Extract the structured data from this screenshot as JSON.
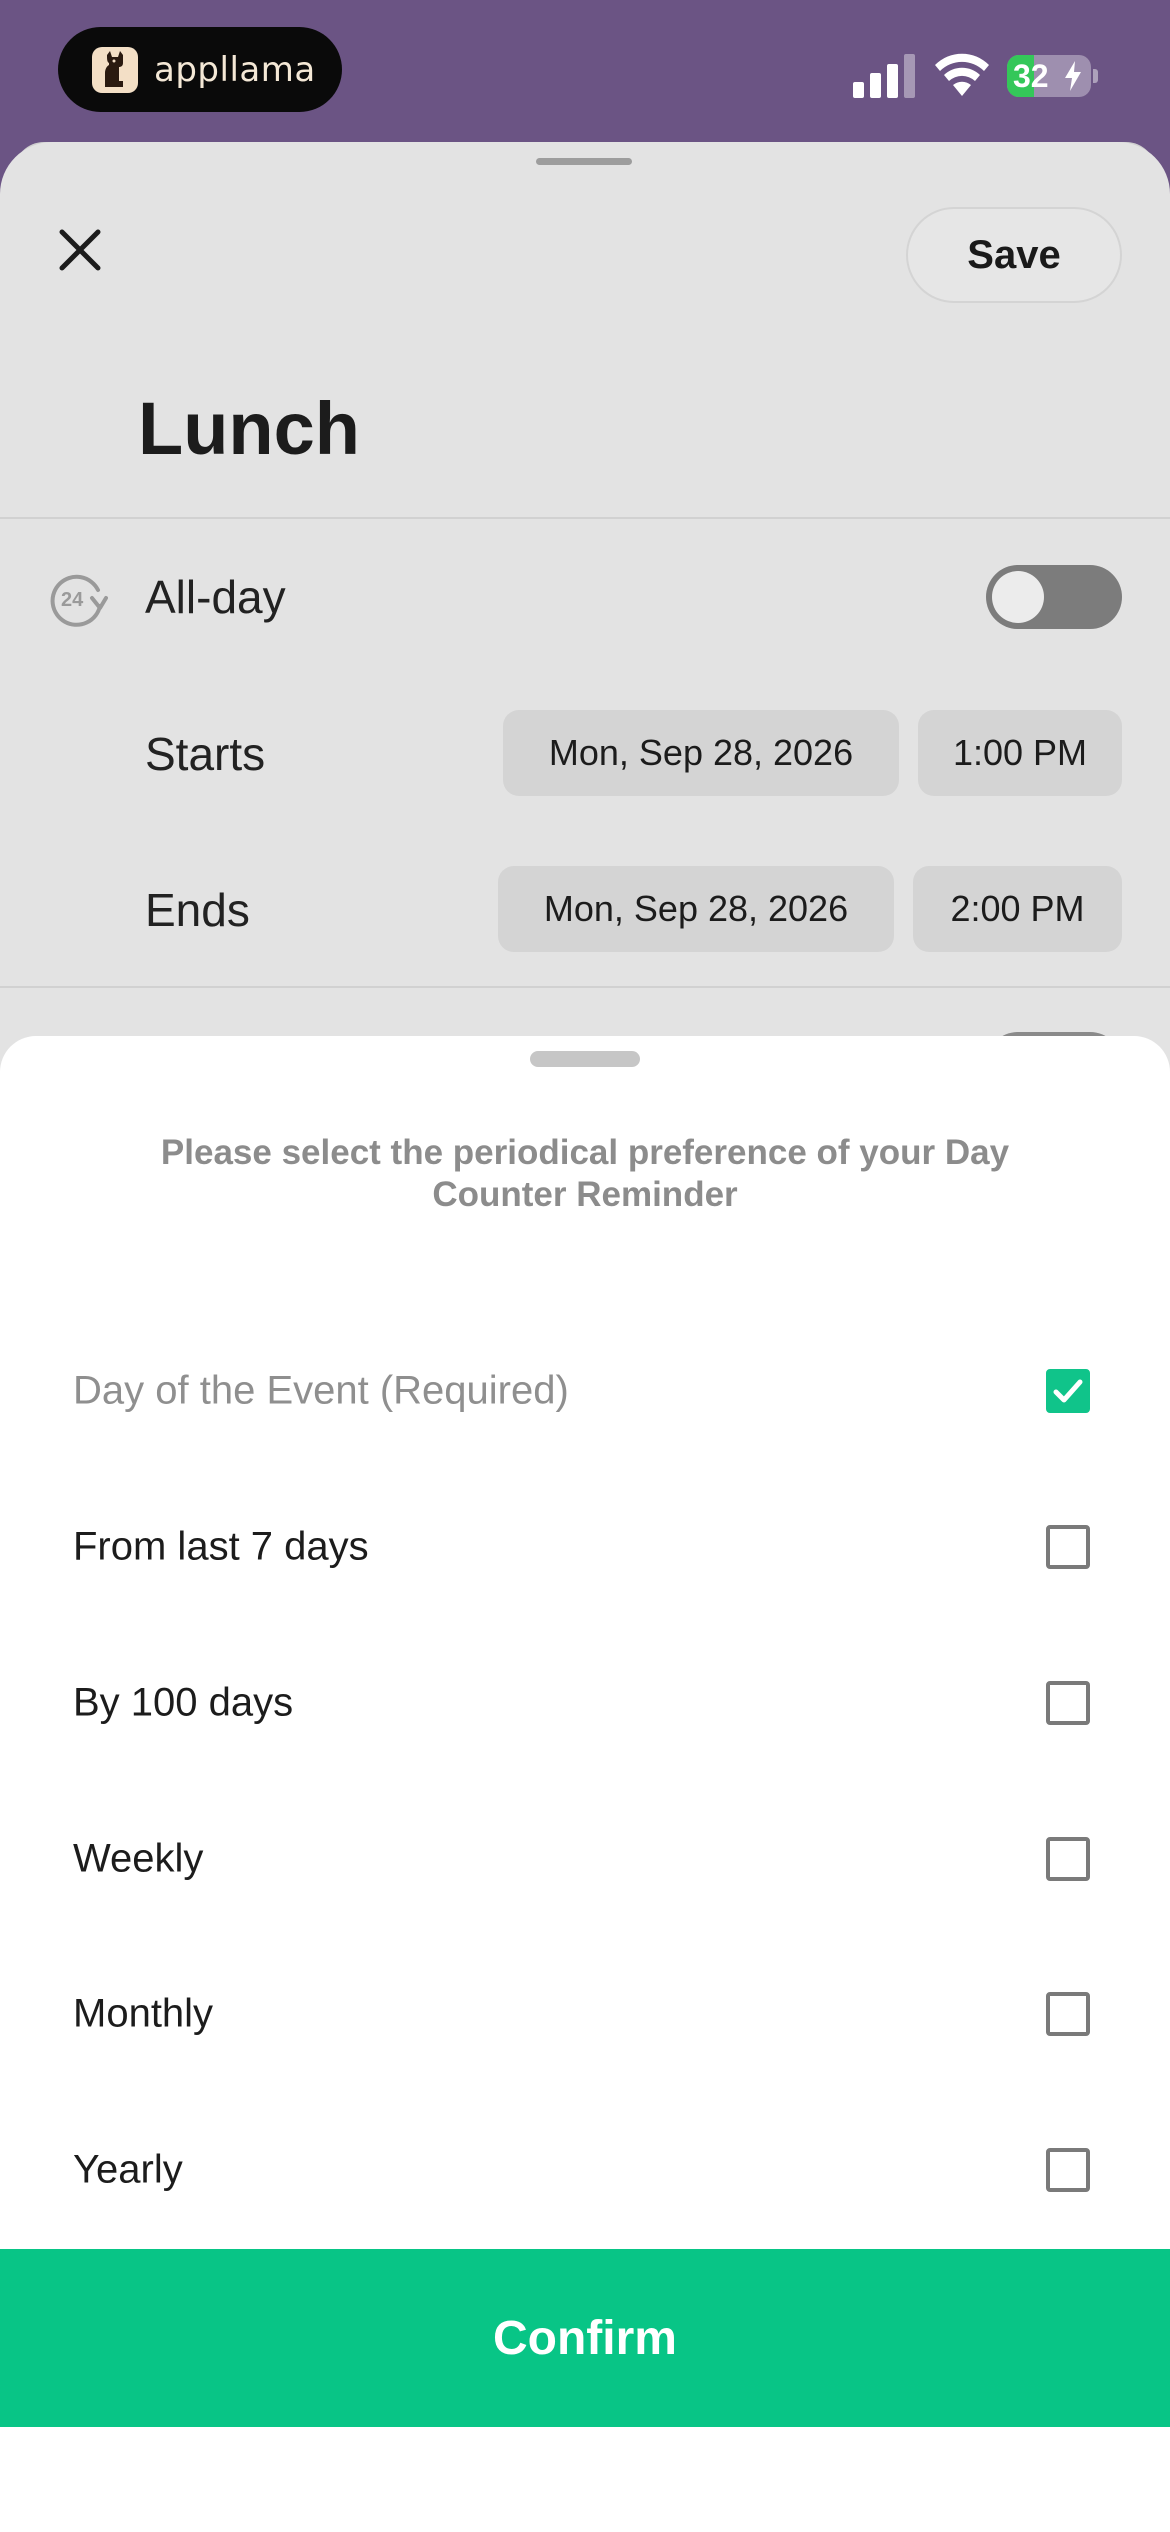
{
  "status_bar": {
    "app_name": "appllama",
    "battery_level": "32",
    "battery_fraction": 0.32
  },
  "event": {
    "close_icon": "close-icon",
    "save_label": "Save",
    "title": "Lunch",
    "all_day_label": "All-day",
    "all_day_on": false,
    "starts_label": "Starts",
    "starts_date": "Mon, Sep 28, 2026",
    "starts_time": "1:00 PM",
    "ends_label": "Ends",
    "ends_date": "Mon, Sep 28, 2026",
    "ends_time": "2:00 PM"
  },
  "reminder_sheet": {
    "prompt": "Please select the periodical preference of your Day Counter Reminder",
    "options": [
      {
        "label": "Day of the Event (Required)",
        "checked": true,
        "disabled": true
      },
      {
        "label": "From last 7 days",
        "checked": false,
        "disabled": false
      },
      {
        "label": "By 100 days",
        "checked": false,
        "disabled": false
      },
      {
        "label": "Weekly",
        "checked": false,
        "disabled": false
      },
      {
        "label": "Monthly",
        "checked": false,
        "disabled": false
      },
      {
        "label": "Yearly",
        "checked": false,
        "disabled": false
      }
    ],
    "confirm_label": "Confirm"
  },
  "colors": {
    "accent": "#08c586",
    "backdrop": "#6b5484",
    "sheet_dim": "#e3e3e3"
  }
}
